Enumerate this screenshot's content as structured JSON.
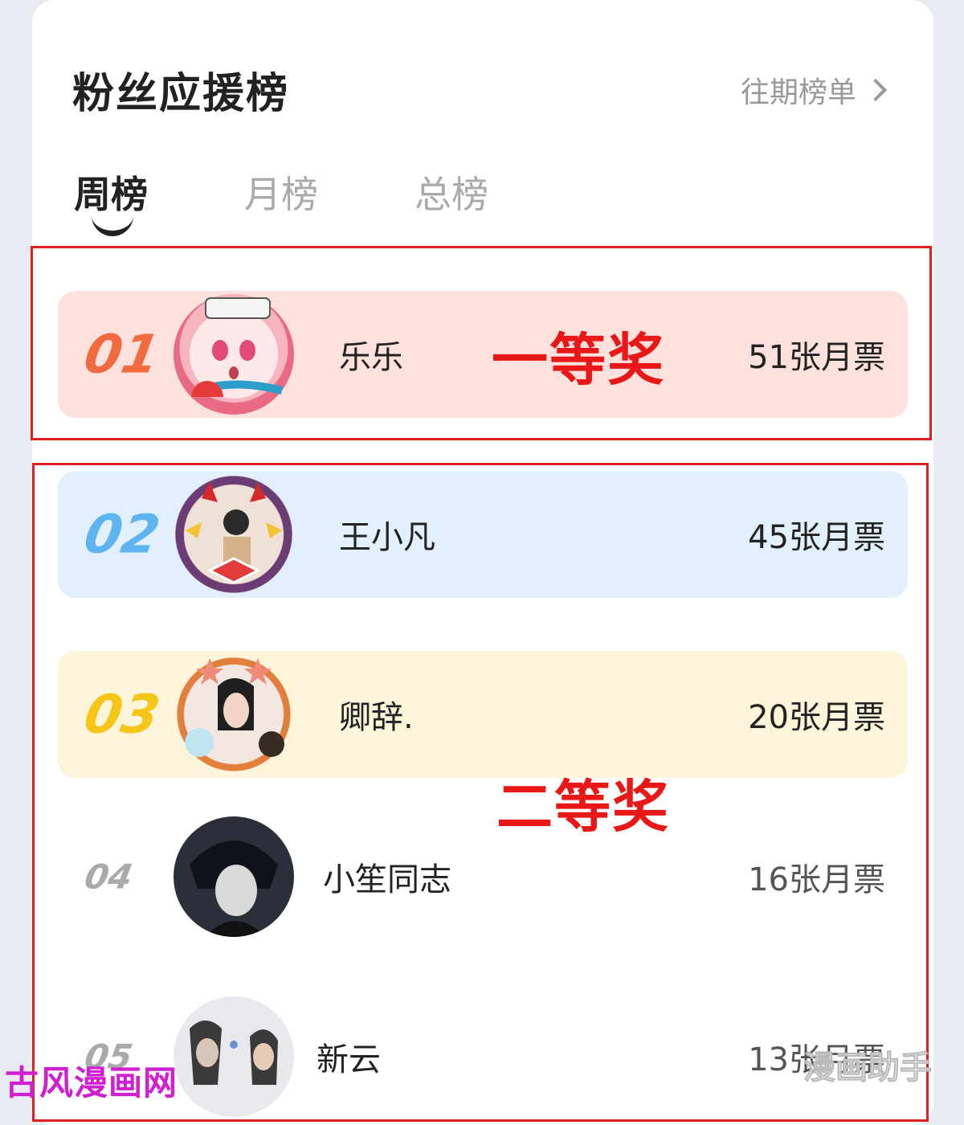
{
  "header": {
    "title": "粉丝应援榜",
    "history_label": "往期榜单"
  },
  "tabs": [
    {
      "label": "周榜",
      "active": true
    },
    {
      "label": "月榜",
      "active": false
    },
    {
      "label": "总榜",
      "active": false
    }
  ],
  "ranking": [
    {
      "rank": "01",
      "name": "乐乐",
      "votes": "51张月票",
      "bg": "#fde1dc",
      "rank_color": "#f26a3f"
    },
    {
      "rank": "02",
      "name": "王小凡",
      "votes": "45张月票",
      "bg": "#e2f0fd",
      "rank_color": "#5eb4ef"
    },
    {
      "rank": "03",
      "name": "卿辞.",
      "votes": "20张月票",
      "bg": "#fdf5d9",
      "rank_color": "#f5c518"
    },
    {
      "rank": "04",
      "name": "小笙同志",
      "votes": "16张月票"
    },
    {
      "rank": "05",
      "name": "新云",
      "votes": "13张月票"
    }
  ],
  "annotations": {
    "first_prize": "一等奖",
    "second_prize": "二等奖"
  },
  "watermarks": {
    "left": "古风漫画网",
    "right": "漫画助手"
  }
}
